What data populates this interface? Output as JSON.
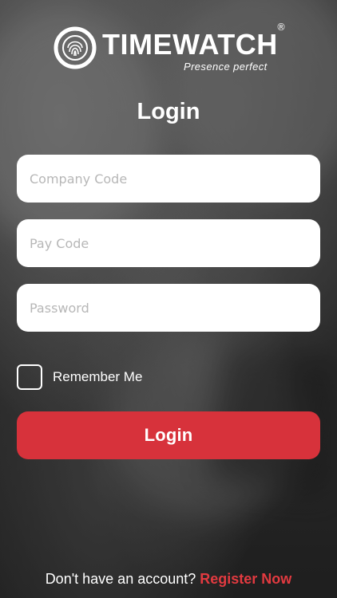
{
  "brand": {
    "name": "TIMEWATCH",
    "registered_mark": "®",
    "tagline": "Presence perfect",
    "logo_icon": "fingerprint-icon"
  },
  "login": {
    "title": "Login",
    "company_code_placeholder": "Company Code",
    "pay_code_placeholder": "Pay Code",
    "password_placeholder": "Password",
    "remember_label": "Remember Me",
    "submit_label": "Login"
  },
  "footer": {
    "prompt": "Don't have an account?",
    "register_label": "Register Now"
  },
  "colors": {
    "accent": "#d7323b",
    "link": "#e23a40",
    "text": "#ffffff",
    "field_bg": "#ffffff",
    "placeholder": "#b7b7b7"
  }
}
